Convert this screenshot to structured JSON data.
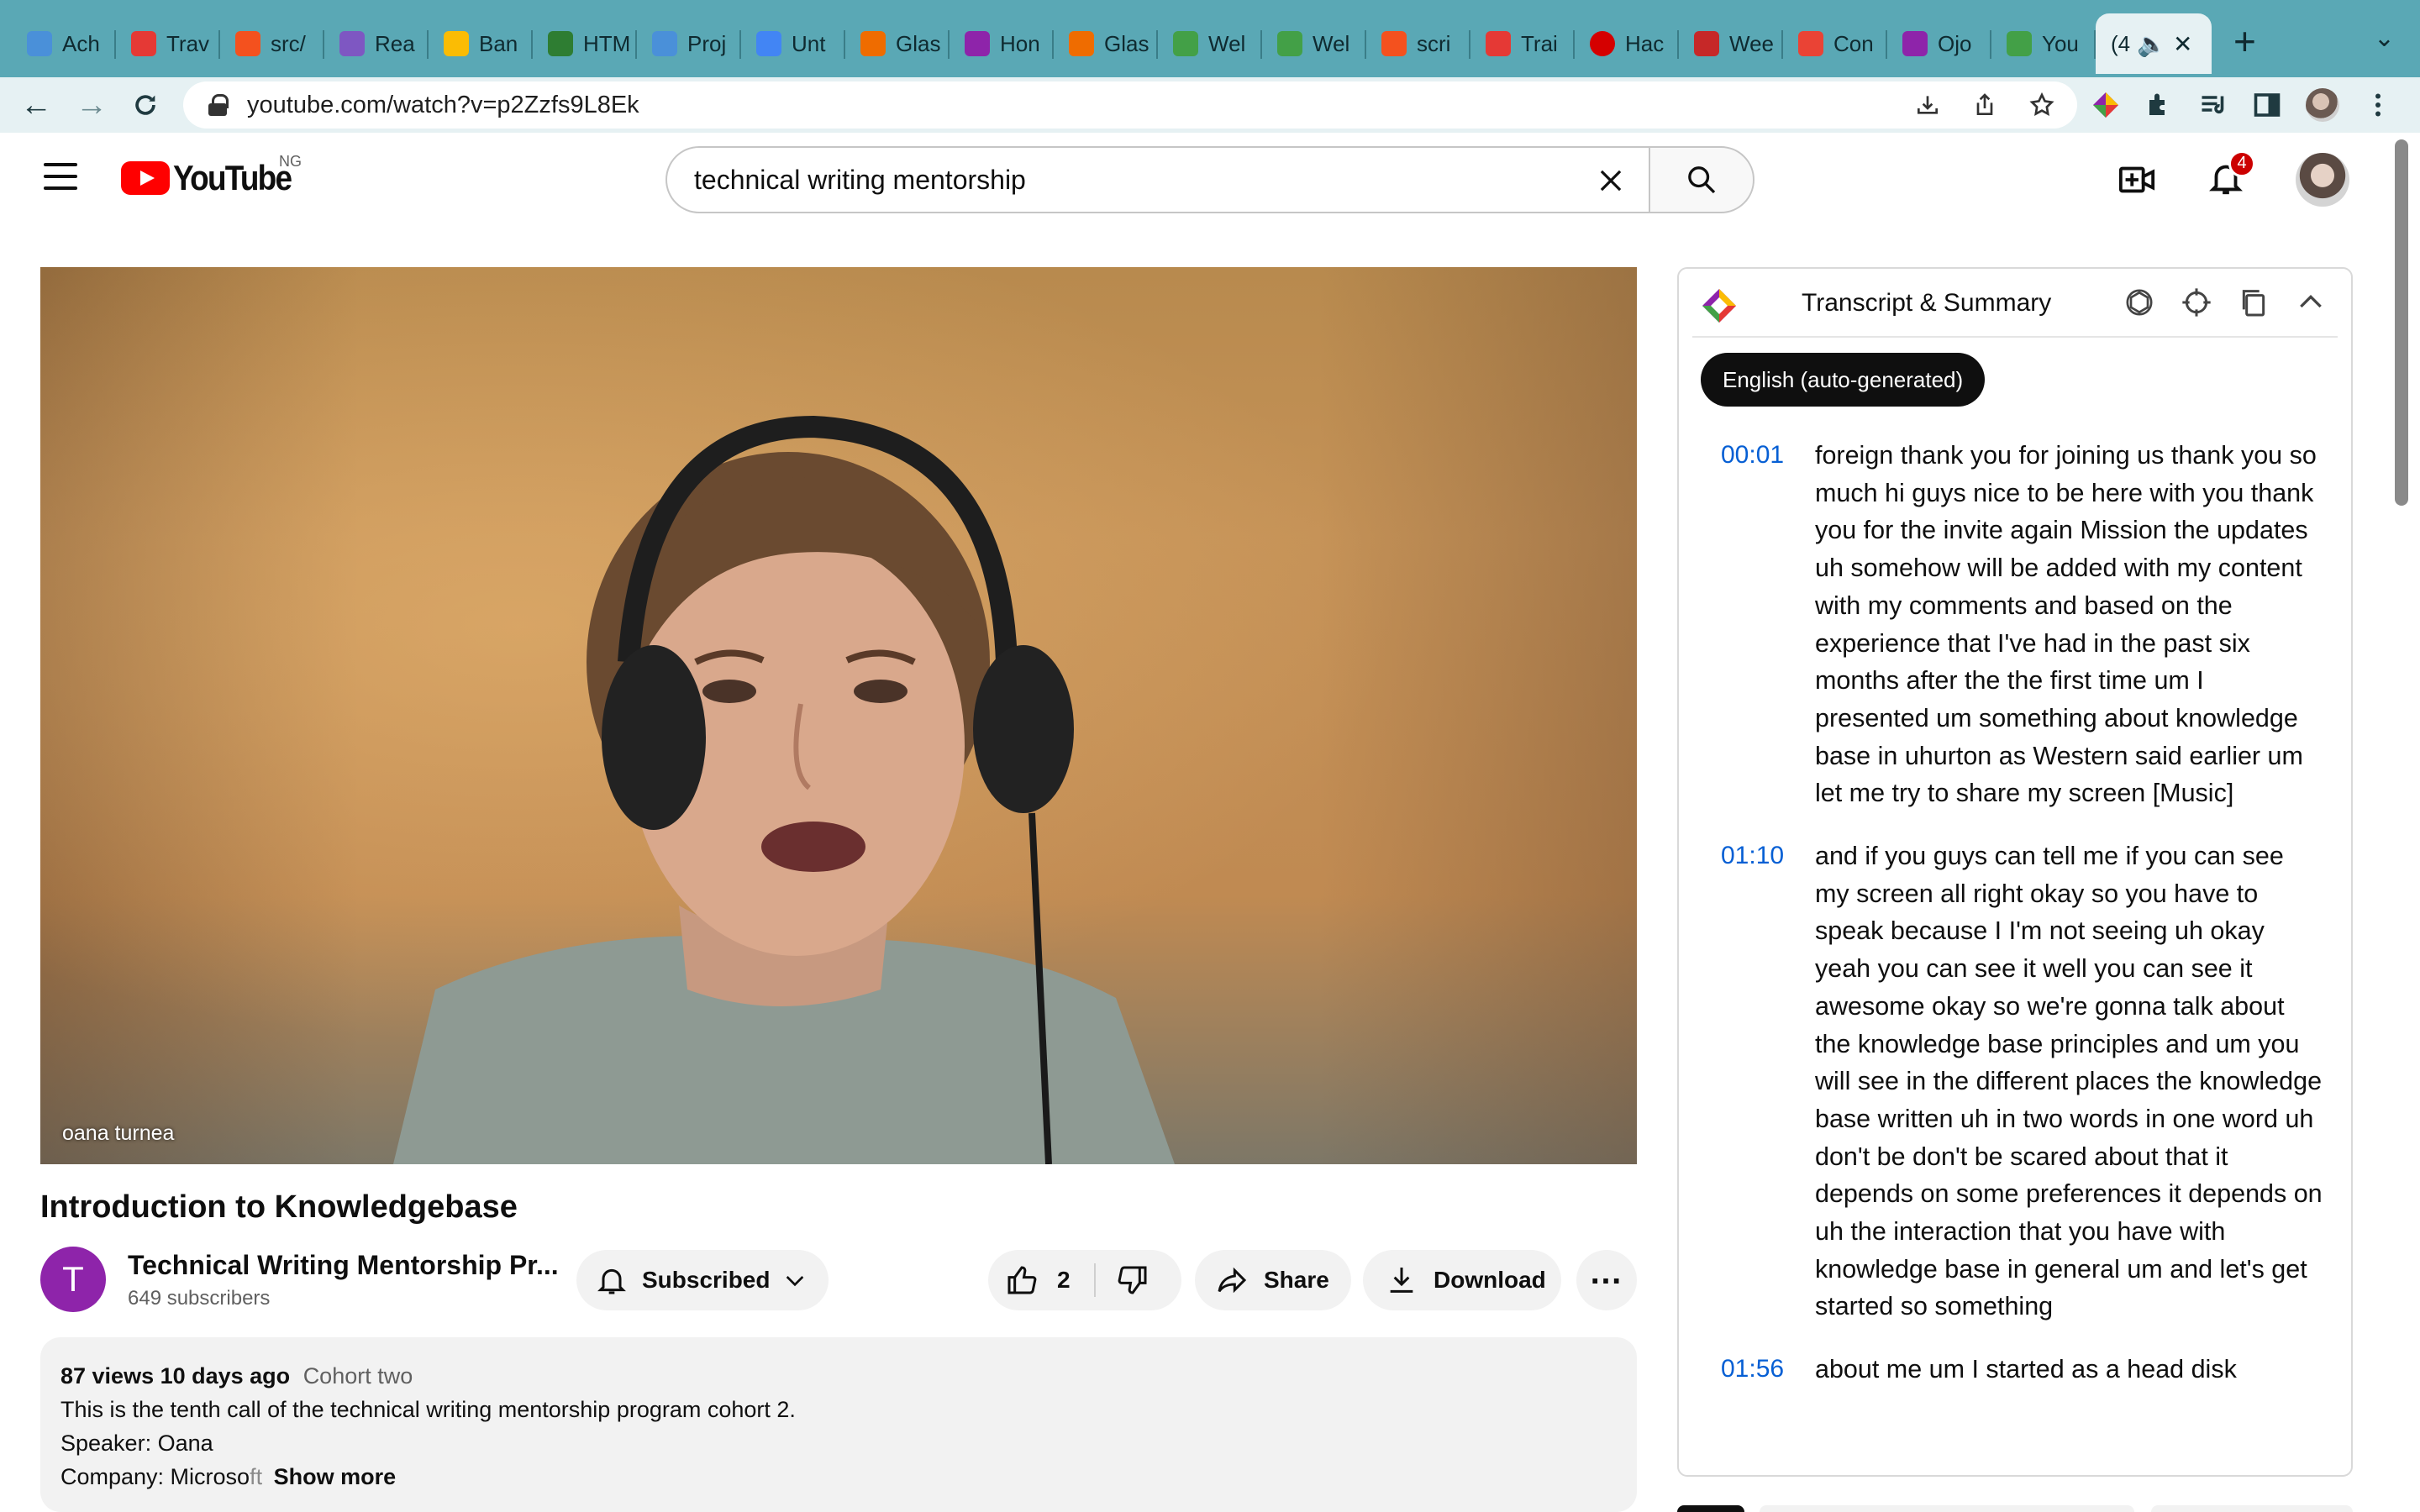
{
  "browser": {
    "tabs": [
      {
        "label": "Ach",
        "fav_color": "#4a90d9"
      },
      {
        "label": "Trav",
        "fav_color": "#e53935"
      },
      {
        "label": "src/",
        "fav_color": "#f4511e"
      },
      {
        "label": "Rea",
        "fav_color": "#7e57c2"
      },
      {
        "label": "Ban",
        "fav_color": "#fbbc04"
      },
      {
        "label": "HTM",
        "fav_color": "#2e7d32"
      },
      {
        "label": "Proj",
        "fav_color": "#4a90d9"
      },
      {
        "label": "Unt",
        "fav_color": "#4285f4"
      },
      {
        "label": "Glas",
        "fav_color": "#ef6c00"
      },
      {
        "label": "Hon",
        "fav_color": "#8e24aa"
      },
      {
        "label": "Glas",
        "fav_color": "#ef6c00"
      },
      {
        "label": "Wel",
        "fav_color": "#43a047"
      },
      {
        "label": "Wel",
        "fav_color": "#43a047"
      },
      {
        "label": "scri",
        "fav_color": "#f4511e"
      },
      {
        "label": "Trai",
        "fav_color": "#e53935"
      },
      {
        "label": "Hac",
        "fav_color": "#d50000"
      },
      {
        "label": "Wee",
        "fav_color": "#c62828"
      },
      {
        "label": "Con",
        "fav_color": "#ea4335"
      },
      {
        "label": "Ojo",
        "fav_color": "#8e24aa"
      },
      {
        "label": "You",
        "fav_color": "#43a047"
      }
    ],
    "active_tab": {
      "label": "(4"
    },
    "url": "youtube.com/watch?v=p2Zzfs9L8Ek"
  },
  "youtube": {
    "logo_text": "YouTube",
    "region": "NG",
    "search_query": "technical writing mentorship",
    "notification_count": "4"
  },
  "video": {
    "overlay_name": "oana turnea",
    "title": "Introduction to Knowledgebase",
    "channel_initial": "T",
    "channel_name": "Technical Writing Mentorship Pr...",
    "subscribers": "649 subscribers",
    "subscribe_label": "Subscribed",
    "like_count": "2",
    "share_label": "Share",
    "download_label": "Download"
  },
  "description": {
    "stats": "87 views  10 days ago",
    "tag": "Cohort two",
    "line1": "This is the tenth call of the technical writing mentorship program cohort 2.",
    "line2": "Speaker: Oana",
    "line3_main": "Company: Microso",
    "line3_faded": "ft",
    "show_more": "Show more"
  },
  "transcript": {
    "title": "Transcript & Summary",
    "language": "English (auto-generated)",
    "segments": [
      {
        "time": "00:01",
        "text": "foreign thank you for joining us thank you so much hi guys nice to be here with you thank you for the invite again Mission the updates uh somehow will be added with my content with my comments and based on the experience that I've had in the past six months after the the first time um I presented um something about knowledge base in uhurton as Western said earlier um let me try to share my screen [Music]"
      },
      {
        "time": "01:10",
        "text": "and if you guys can tell me if you can see my screen all right okay so you have to speak because I I'm not seeing uh okay yeah you can see it well you can see it awesome okay so we're gonna talk about the knowledge base principles and um you will see in the different places the knowledge base written uh in two words in one word uh don't be don't be scared about that it depends on some preferences it depends on uh the interaction that you have with knowledge base in general um and let's get started so something"
      },
      {
        "time": "01:56",
        "text": "about me um I started as a head disk"
      }
    ]
  }
}
